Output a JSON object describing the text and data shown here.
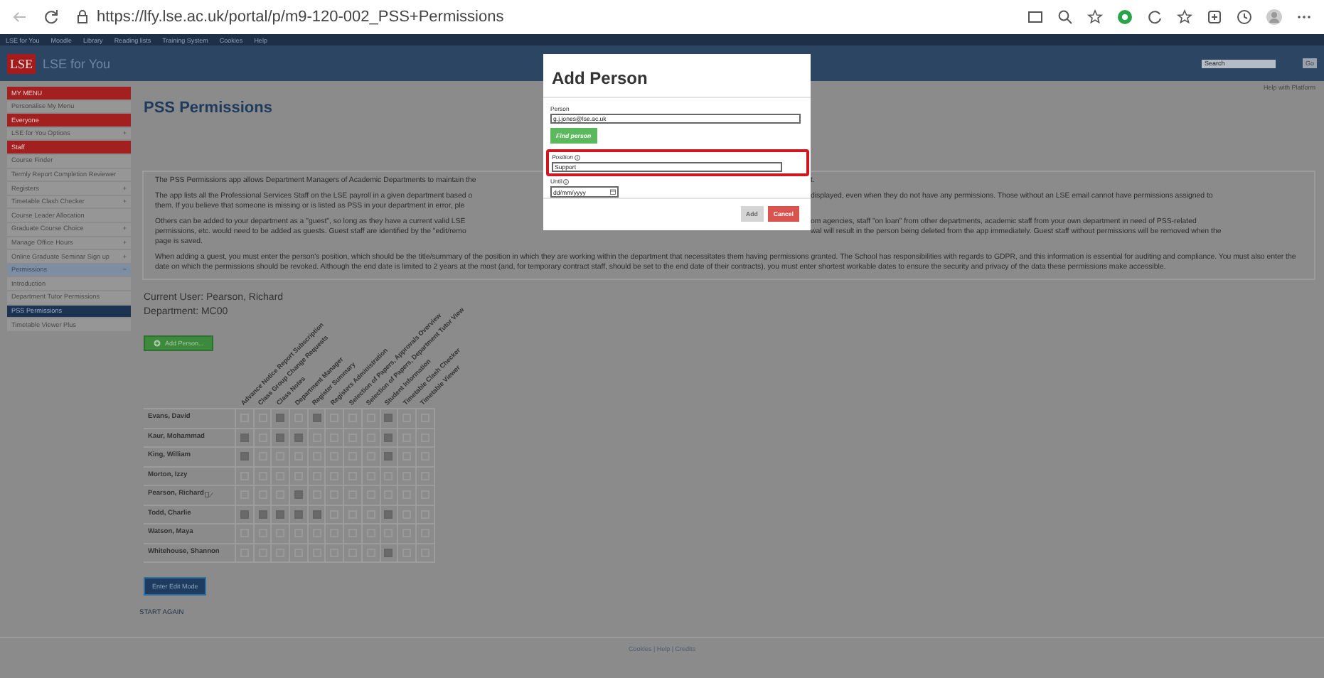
{
  "browser": {
    "url": "https://lfy.lse.ac.uk/portal/p/m9-120-002_PSS+Permissions"
  },
  "nav": [
    "LSE for You",
    "Moodle",
    "Library",
    "Reading lists",
    "Training System",
    "Cookies",
    "Help"
  ],
  "header": {
    "logo": "LSE",
    "title": "LSE for You",
    "search_placeholder": "Search",
    "go": "Go"
  },
  "help_link": "Help with Platform",
  "sidebar": [
    {
      "label": "MY MENU",
      "kind": "header",
      "selected": false
    },
    {
      "label": "Personalise My Menu",
      "kind": "item",
      "selected": false
    },
    {
      "label": "Everyone",
      "kind": "header",
      "selected": false
    },
    {
      "label": "LSE for You Options",
      "kind": "item",
      "toggle": "+",
      "selected": false
    },
    {
      "label": "Staff",
      "kind": "header",
      "selected": false
    },
    {
      "label": "Course Finder",
      "kind": "item",
      "selected": false
    },
    {
      "label": "Termly Report Completion Reviewer",
      "kind": "item",
      "selected": false
    },
    {
      "label": "Registers",
      "kind": "item",
      "toggle": "+",
      "selected": false
    },
    {
      "label": "Timetable Clash Checker",
      "kind": "item",
      "toggle": "+",
      "selected": false
    },
    {
      "label": "Course Leader Allocation",
      "kind": "item",
      "selected": false
    },
    {
      "label": "Graduate Course Choice",
      "kind": "item",
      "toggle": "+",
      "selected": false
    },
    {
      "label": "Manage Office Hours",
      "kind": "item",
      "toggle": "+",
      "selected": false
    },
    {
      "label": "Online Graduate Seminar Sign up",
      "kind": "item",
      "toggle": "+",
      "selected": false
    },
    {
      "label": "Permissions",
      "kind": "group",
      "toggle": "−",
      "selected": false
    },
    {
      "label": "Introduction",
      "kind": "item",
      "selected": false
    },
    {
      "label": "Department Tutor Permissions",
      "kind": "item",
      "selected": false
    },
    {
      "label": "PSS Permissions",
      "kind": "item",
      "selected": true
    },
    {
      "label": "Timetable Viewer Plus",
      "kind": "item",
      "selected": false
    }
  ],
  "page_title": "PSS Permissions",
  "intro": [
    {
      "kind": "split",
      "lines": [
        {
          "left": "The PSS Permissions app allows Department Managers of Academic Departments to maintain the",
          "right": "t."
        }
      ]
    },
    {
      "kind": "split",
      "lines": [
        {
          "left": "The app lists all the Professional Services Staff on the LSE payroll in a given department based o",
          "right": "displayed, even when they do not have any permissions. Those without an LSE email cannot have permissions assigned to"
        },
        {
          "left": "them. If you believe that someone is missing or is listed as PSS in your department in error, ple"
        }
      ]
    },
    {
      "kind": "split",
      "lines": [
        {
          "left": "Others can be added to your department as a \"guest\", so long as they have a current valid LSE",
          "right": "om agencies, staff \"on loan\" from other departments, academic staff from your own department in need of PSS-related"
        },
        {
          "left": "permissions, etc. would need to be added as guests. Guest staff are identified by the \"edit/remo",
          "right": "wal will result in the person being deleted from the app immediately. Guest staff without permissions will be removed when the"
        },
        {
          "left": "page is saved."
        }
      ]
    },
    {
      "kind": "plain",
      "text": "When adding a guest, you must enter the person's position, which should be the title/summary of the position in which they are working within the department that necessitates them having permissions granted. The School has responsibilities with regards to GDPR, and this information is essential for auditing and compliance. You must also enter the date on which the permissions should be revoked. Although the end date is limited to 2 years at the most (and, for temporary contract staff, should be set to the end date of their contracts), you must enter shortest workable dates to ensure the security and privacy of the data these permissions make accessible."
    }
  ],
  "current_user": "Current User: Pearson, Richard",
  "department": "Department: MC00",
  "add_button": "Add Person...",
  "table": {
    "columns": [
      "Advance Notice Report Subscription",
      "Class Group Change Requests",
      "Class Notes",
      "Department Manager",
      "Register Summary",
      "Registers Administration",
      "Selection of Papers, Approvals Overview",
      "Selection of Papers, Department Tutor View",
      "Student Information",
      "Timetable Clash Checker",
      "Timetable Viewer"
    ],
    "rows": [
      {
        "name": "Evans, David",
        "note_icon": false,
        "cells": [
          false,
          false,
          true,
          false,
          true,
          false,
          false,
          false,
          true,
          false,
          false
        ]
      },
      {
        "name": "Kaur, Mohammad",
        "note_icon": false,
        "cells": [
          true,
          false,
          true,
          true,
          false,
          false,
          false,
          false,
          true,
          false,
          false
        ]
      },
      {
        "name": "King, William",
        "note_icon": false,
        "cells": [
          true,
          false,
          false,
          false,
          false,
          false,
          false,
          false,
          true,
          false,
          false
        ]
      },
      {
        "name": "Morton, Izzy",
        "note_icon": false,
        "cells": [
          false,
          false,
          false,
          false,
          false,
          false,
          false,
          false,
          false,
          false,
          false
        ]
      },
      {
        "name": "Pearson, Richard",
        "note_icon": true,
        "cells": [
          false,
          false,
          false,
          true,
          false,
          false,
          false,
          false,
          false,
          false,
          false
        ]
      },
      {
        "name": "Todd, Charlie",
        "note_icon": false,
        "cells": [
          true,
          true,
          true,
          true,
          true,
          false,
          false,
          false,
          true,
          false,
          false
        ]
      },
      {
        "name": "Watson, Maya",
        "note_icon": false,
        "cells": [
          false,
          false,
          false,
          false,
          false,
          false,
          false,
          false,
          false,
          false,
          false
        ]
      },
      {
        "name": "Whitehouse, Shannon",
        "note_icon": false,
        "cells": [
          false,
          false,
          false,
          false,
          false,
          false,
          false,
          false,
          true,
          false,
          false
        ]
      }
    ]
  },
  "edit_button": "Enter Edit Mode",
  "start_again": "START AGAIN",
  "footer": "Cookies | Help | Credits",
  "modal": {
    "title": "Add Person",
    "person_label": "Person",
    "person_value": "g.j.jones@lse.ac.uk",
    "find_button": "Find person",
    "position_label": "Position",
    "position_value": "Support",
    "position_highlighted": true,
    "until_label": "Until",
    "until_placeholder": "dd/mm/yyyy",
    "add": {
      "label": "Add",
      "disabled": true
    },
    "cancel": "Cancel"
  }
}
